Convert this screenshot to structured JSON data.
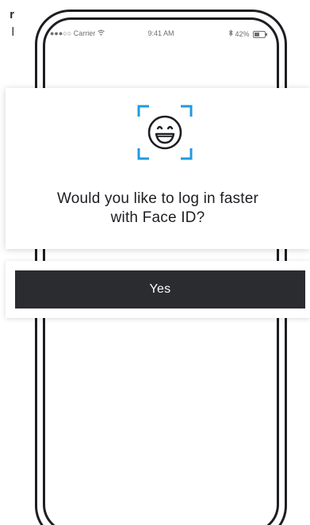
{
  "caption": {
    "line1": "r",
    "line2": "l"
  },
  "status_bar": {
    "carrier": "Carrier",
    "signal_dots": "●●●○○",
    "time": "9:41 AM",
    "battery_percent": "42%"
  },
  "dialog": {
    "icon": "face-id-smile-icon",
    "question_line1": "Would you like to log in faster",
    "question_line2": "with Face ID?",
    "yes_label": "Yes"
  },
  "colors": {
    "accent_blue": "#1e9be0",
    "dark": "#2b2c30",
    "frame": "#1d1e22"
  }
}
